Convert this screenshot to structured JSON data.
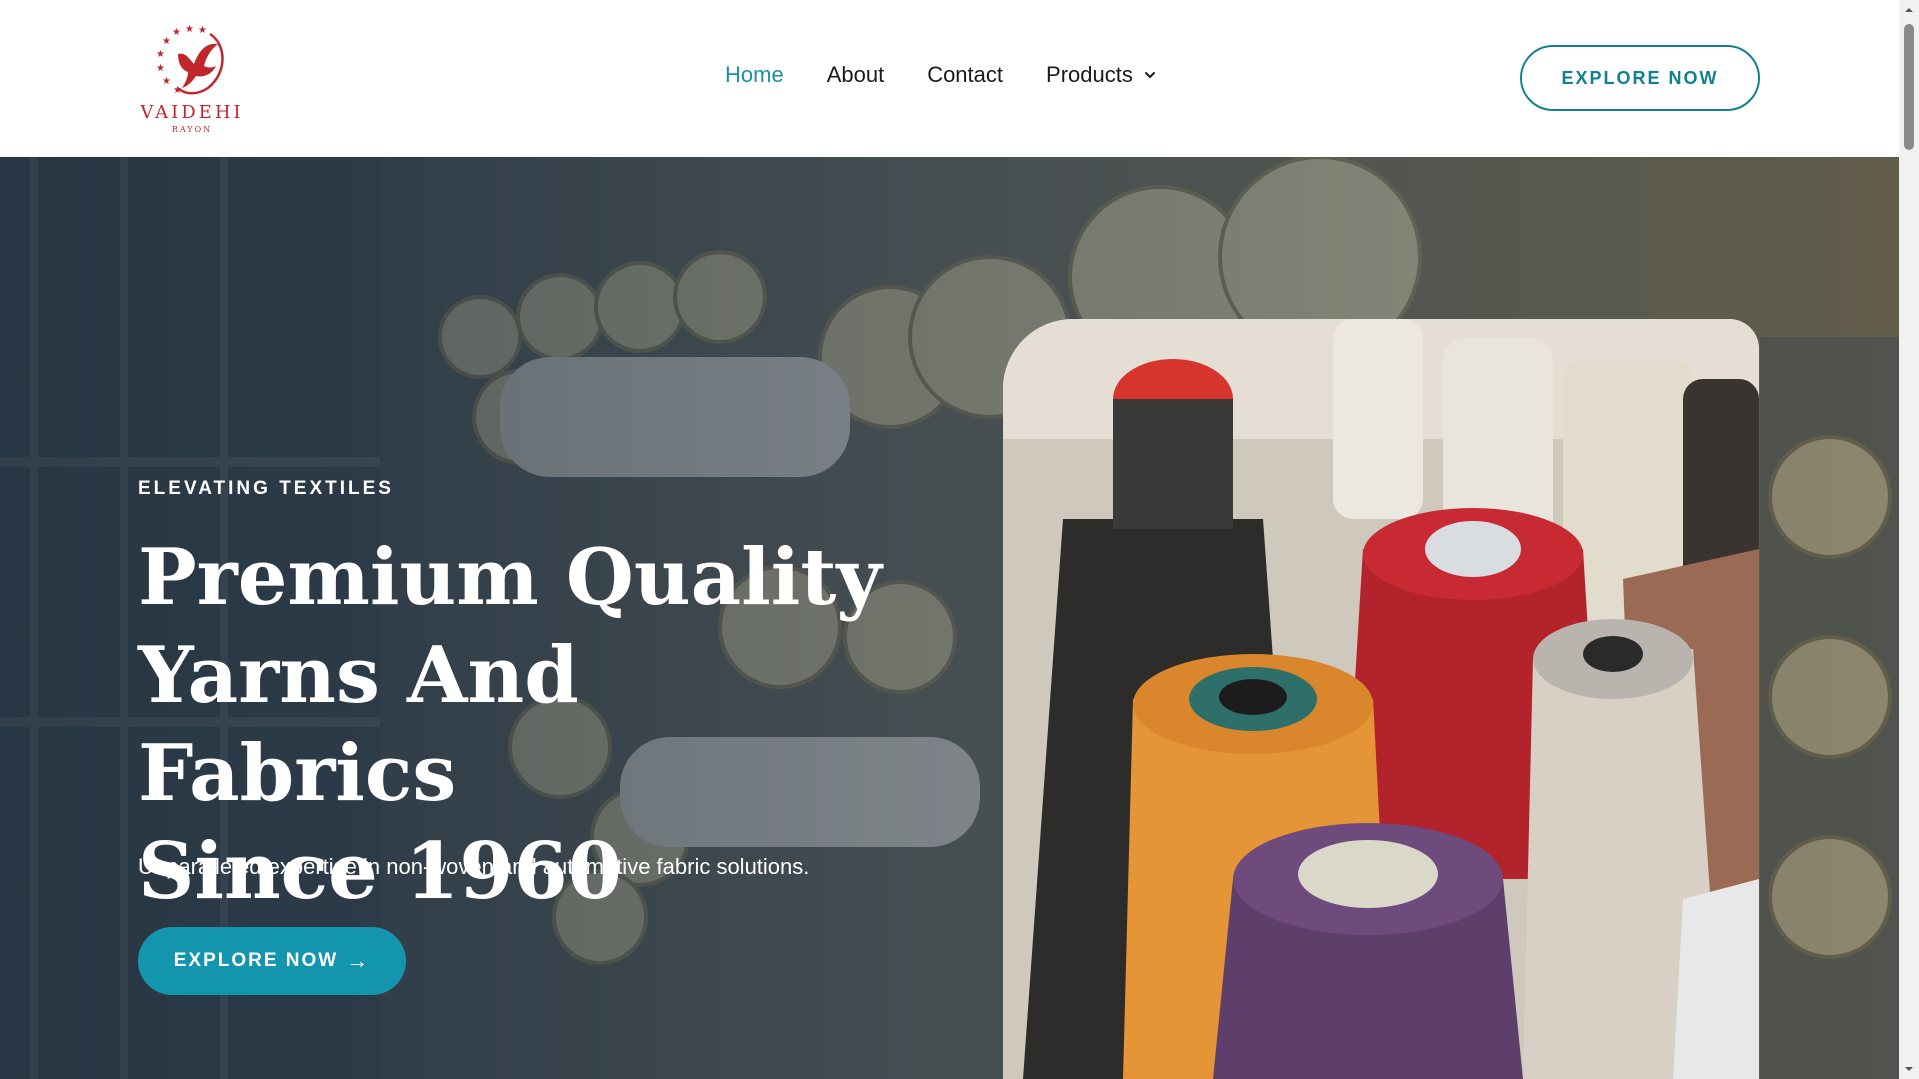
{
  "brand": {
    "name": "VAIDEHI",
    "sub": "RAYON",
    "color": "#c0272d"
  },
  "nav": {
    "items": [
      {
        "label": "Home",
        "active": true
      },
      {
        "label": "About",
        "active": false
      },
      {
        "label": "Contact",
        "active": false
      },
      {
        "label": "Products",
        "active": false
      }
    ]
  },
  "header_cta": {
    "label": "EXPLORE NOW"
  },
  "hero": {
    "eyebrow": "ELEVATING TEXTILES",
    "headline_lines": [
      "Premium Quality",
      "Yarns And Fabrics",
      "Since 1960"
    ],
    "subtitle": "Unparalleled expertise in non-woven and automotive fabric solutions.",
    "cta_label": "EXPLORE NOW",
    "cta_icon": "arrow-right-icon"
  },
  "colors": {
    "accent": "#1396ad",
    "accent_dark": "#12808f",
    "active_nav": "#1a8fa6"
  }
}
